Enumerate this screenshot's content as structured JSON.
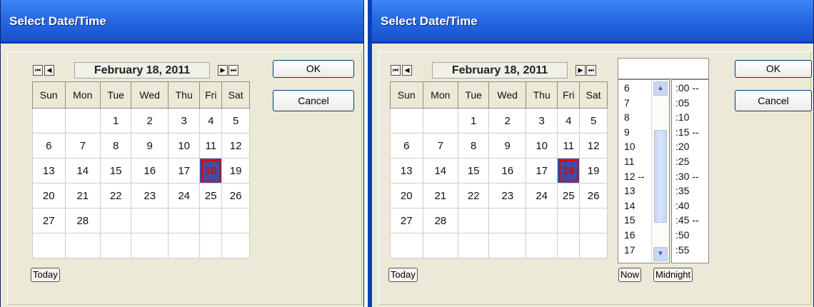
{
  "left_dialog": {
    "title": "Select Date/Time",
    "month_label": "February 18, 2011",
    "nav": {
      "first": "⏮",
      "prev": "◀",
      "next": "▶",
      "last": "⏭"
    },
    "weekdays": [
      "Sun",
      "Mon",
      "Tue",
      "Wed",
      "Thu",
      "Fri",
      "Sat"
    ],
    "weeks": [
      [
        "",
        "",
        "1",
        "2",
        "3",
        "4",
        "5"
      ],
      [
        "6",
        "7",
        "8",
        "9",
        "10",
        "11",
        "12"
      ],
      [
        "13",
        "14",
        "15",
        "16",
        "17",
        "18",
        "19"
      ],
      [
        "20",
        "21",
        "22",
        "23",
        "24",
        "25",
        "26"
      ],
      [
        "27",
        "28",
        "",
        "",
        "",
        "",
        ""
      ],
      [
        "",
        "",
        "",
        "",
        "",
        "",
        ""
      ]
    ],
    "selected_day": "18",
    "ok_label": "OK",
    "cancel_label": "Cancel",
    "today_label": "Today"
  },
  "right_dialog": {
    "title": "Select Date/Time",
    "month_label": "February 18, 2011",
    "nav": {
      "first": "⏮",
      "prev": "◀",
      "next": "▶",
      "last": "⏭"
    },
    "weekdays": [
      "Sun",
      "Mon",
      "Tue",
      "Wed",
      "Thu",
      "Fri",
      "Sat"
    ],
    "weeks": [
      [
        "",
        "",
        "1",
        "2",
        "3",
        "4",
        "5"
      ],
      [
        "6",
        "7",
        "8",
        "9",
        "10",
        "11",
        "12"
      ],
      [
        "13",
        "14",
        "15",
        "16",
        "17",
        "18",
        "19"
      ],
      [
        "20",
        "21",
        "22",
        "23",
        "24",
        "25",
        "26"
      ],
      [
        "27",
        "28",
        "",
        "",
        "",
        "",
        ""
      ],
      [
        "",
        "",
        "",
        "",
        "",
        "",
        ""
      ]
    ],
    "selected_day": "18",
    "time_value": "",
    "hours": [
      "6",
      "7",
      "8",
      "9",
      "10",
      "11",
      "12 --",
      "13",
      "14",
      "15",
      "16",
      "17"
    ],
    "minutes": [
      ":00 --",
      ":05",
      ":10",
      ":15 --",
      ":20",
      ":25",
      ":30 --",
      ":35",
      ":40",
      ":45 --",
      ":50",
      ":55"
    ],
    "ok_label": "OK",
    "cancel_label": "Cancel",
    "today_label": "Today",
    "now_label": "Now",
    "midnight_label": "Midnight"
  },
  "colors": {
    "titlebar": "#2b6fe6",
    "selected_cell": "#3c4fa3",
    "selected_text": "#e00000",
    "dialog_bg": "#ece9d8"
  }
}
